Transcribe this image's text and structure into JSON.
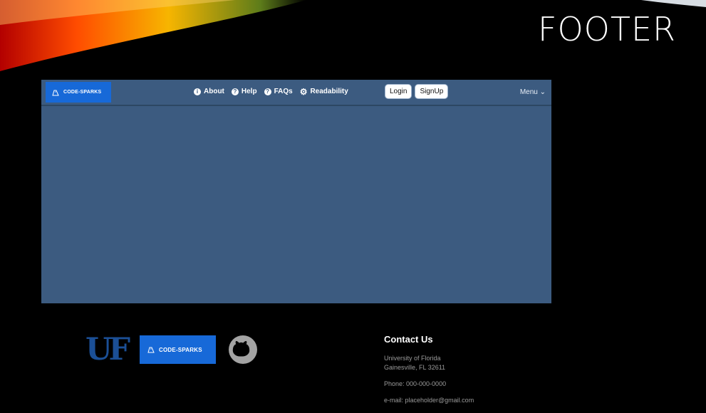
{
  "slide": {
    "title": "FOOTER"
  },
  "navbar": {
    "brand_text": "CODE-SPARKS",
    "links": [
      {
        "label": "About",
        "icon": "info-icon"
      },
      {
        "label": "Help",
        "icon": "question-icon"
      },
      {
        "label": "FAQs",
        "icon": "question-icon"
      },
      {
        "label": "Readability",
        "icon": "gears-icon"
      }
    ],
    "login_label": "Login",
    "signup_label": "SignUp",
    "menu_label": "Menu",
    "colors": {
      "bg": "#3c5b80",
      "brand_bg": "#1769d8"
    }
  },
  "footer": {
    "uf_logo_text": "UF",
    "brand_text": "CODE-SPARKS",
    "contact_title": "Contact Us",
    "address_line1": "University of Florida",
    "address_line2": "Gainesville, FL 32611",
    "phone": "Phone: 000-000-0000",
    "email": "e-mail: placeholder@gmail.com"
  }
}
